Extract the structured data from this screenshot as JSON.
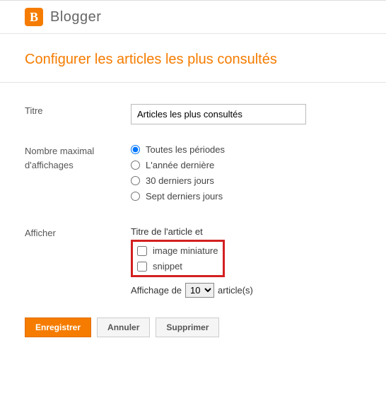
{
  "brand": "Blogger",
  "page_title": "Configurer les articles les plus consultés",
  "fields": {
    "title_label": "Titre",
    "title_value": "Articles les plus consultés",
    "max_display_label": "Nombre maximal d'affichages",
    "periods": {
      "all": "Toutes les périodes",
      "year": "L'année dernière",
      "days30": "30 derniers jours",
      "days7": "Sept derniers jours"
    },
    "show_label": "Afficher",
    "post_title_and": "Titre de l'article et",
    "thumb": "image miniature",
    "snippet": "snippet",
    "display_of": "Affichage de",
    "count_value": "10",
    "articles_suffix": "article(s)"
  },
  "buttons": {
    "save": "Enregistrer",
    "cancel": "Annuler",
    "delete": "Supprimer"
  }
}
